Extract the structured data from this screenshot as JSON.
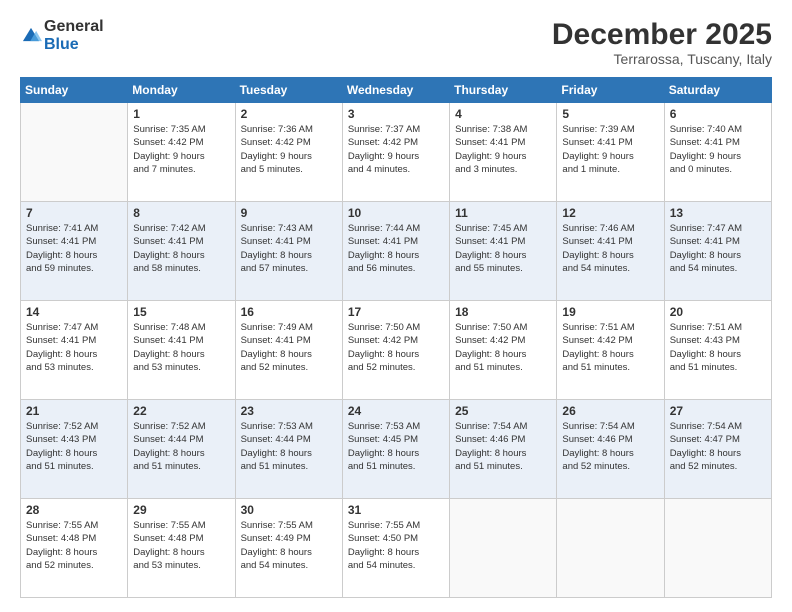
{
  "logo": {
    "general": "General",
    "blue": "Blue"
  },
  "title": "December 2025",
  "location": "Terrarossa, Tuscany, Italy",
  "weekdays": [
    "Sunday",
    "Monday",
    "Tuesday",
    "Wednesday",
    "Thursday",
    "Friday",
    "Saturday"
  ],
  "weeks": [
    [
      {
        "day": "",
        "info": ""
      },
      {
        "day": "1",
        "info": "Sunrise: 7:35 AM\nSunset: 4:42 PM\nDaylight: 9 hours\nand 7 minutes."
      },
      {
        "day": "2",
        "info": "Sunrise: 7:36 AM\nSunset: 4:42 PM\nDaylight: 9 hours\nand 5 minutes."
      },
      {
        "day": "3",
        "info": "Sunrise: 7:37 AM\nSunset: 4:42 PM\nDaylight: 9 hours\nand 4 minutes."
      },
      {
        "day": "4",
        "info": "Sunrise: 7:38 AM\nSunset: 4:41 PM\nDaylight: 9 hours\nand 3 minutes."
      },
      {
        "day": "5",
        "info": "Sunrise: 7:39 AM\nSunset: 4:41 PM\nDaylight: 9 hours\nand 1 minute."
      },
      {
        "day": "6",
        "info": "Sunrise: 7:40 AM\nSunset: 4:41 PM\nDaylight: 9 hours\nand 0 minutes."
      }
    ],
    [
      {
        "day": "7",
        "info": "Sunrise: 7:41 AM\nSunset: 4:41 PM\nDaylight: 8 hours\nand 59 minutes."
      },
      {
        "day": "8",
        "info": "Sunrise: 7:42 AM\nSunset: 4:41 PM\nDaylight: 8 hours\nand 58 minutes."
      },
      {
        "day": "9",
        "info": "Sunrise: 7:43 AM\nSunset: 4:41 PM\nDaylight: 8 hours\nand 57 minutes."
      },
      {
        "day": "10",
        "info": "Sunrise: 7:44 AM\nSunset: 4:41 PM\nDaylight: 8 hours\nand 56 minutes."
      },
      {
        "day": "11",
        "info": "Sunrise: 7:45 AM\nSunset: 4:41 PM\nDaylight: 8 hours\nand 55 minutes."
      },
      {
        "day": "12",
        "info": "Sunrise: 7:46 AM\nSunset: 4:41 PM\nDaylight: 8 hours\nand 54 minutes."
      },
      {
        "day": "13",
        "info": "Sunrise: 7:47 AM\nSunset: 4:41 PM\nDaylight: 8 hours\nand 54 minutes."
      }
    ],
    [
      {
        "day": "14",
        "info": "Sunrise: 7:47 AM\nSunset: 4:41 PM\nDaylight: 8 hours\nand 53 minutes."
      },
      {
        "day": "15",
        "info": "Sunrise: 7:48 AM\nSunset: 4:41 PM\nDaylight: 8 hours\nand 53 minutes."
      },
      {
        "day": "16",
        "info": "Sunrise: 7:49 AM\nSunset: 4:41 PM\nDaylight: 8 hours\nand 52 minutes."
      },
      {
        "day": "17",
        "info": "Sunrise: 7:50 AM\nSunset: 4:42 PM\nDaylight: 8 hours\nand 52 minutes."
      },
      {
        "day": "18",
        "info": "Sunrise: 7:50 AM\nSunset: 4:42 PM\nDaylight: 8 hours\nand 51 minutes."
      },
      {
        "day": "19",
        "info": "Sunrise: 7:51 AM\nSunset: 4:42 PM\nDaylight: 8 hours\nand 51 minutes."
      },
      {
        "day": "20",
        "info": "Sunrise: 7:51 AM\nSunset: 4:43 PM\nDaylight: 8 hours\nand 51 minutes."
      }
    ],
    [
      {
        "day": "21",
        "info": "Sunrise: 7:52 AM\nSunset: 4:43 PM\nDaylight: 8 hours\nand 51 minutes."
      },
      {
        "day": "22",
        "info": "Sunrise: 7:52 AM\nSunset: 4:44 PM\nDaylight: 8 hours\nand 51 minutes."
      },
      {
        "day": "23",
        "info": "Sunrise: 7:53 AM\nSunset: 4:44 PM\nDaylight: 8 hours\nand 51 minutes."
      },
      {
        "day": "24",
        "info": "Sunrise: 7:53 AM\nSunset: 4:45 PM\nDaylight: 8 hours\nand 51 minutes."
      },
      {
        "day": "25",
        "info": "Sunrise: 7:54 AM\nSunset: 4:46 PM\nDaylight: 8 hours\nand 51 minutes."
      },
      {
        "day": "26",
        "info": "Sunrise: 7:54 AM\nSunset: 4:46 PM\nDaylight: 8 hours\nand 52 minutes."
      },
      {
        "day": "27",
        "info": "Sunrise: 7:54 AM\nSunset: 4:47 PM\nDaylight: 8 hours\nand 52 minutes."
      }
    ],
    [
      {
        "day": "28",
        "info": "Sunrise: 7:55 AM\nSunset: 4:48 PM\nDaylight: 8 hours\nand 52 minutes."
      },
      {
        "day": "29",
        "info": "Sunrise: 7:55 AM\nSunset: 4:48 PM\nDaylight: 8 hours\nand 53 minutes."
      },
      {
        "day": "30",
        "info": "Sunrise: 7:55 AM\nSunset: 4:49 PM\nDaylight: 8 hours\nand 54 minutes."
      },
      {
        "day": "31",
        "info": "Sunrise: 7:55 AM\nSunset: 4:50 PM\nDaylight: 8 hours\nand 54 minutes."
      },
      {
        "day": "",
        "info": ""
      },
      {
        "day": "",
        "info": ""
      },
      {
        "day": "",
        "info": ""
      }
    ]
  ]
}
